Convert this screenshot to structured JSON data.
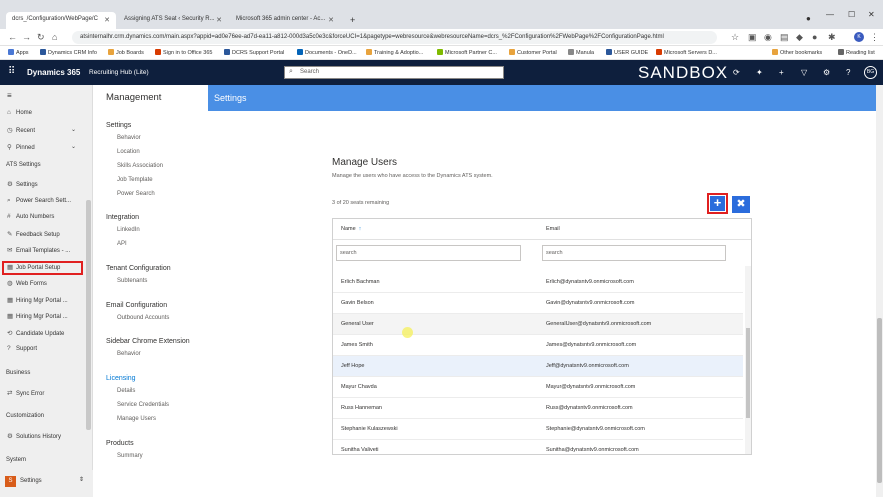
{
  "browser": {
    "tabs": [
      {
        "label": "dcrs_/Configuration/WebPage/C"
      },
      {
        "label": "Assigning ATS Seat ‹ Security R..."
      },
      {
        "label": "Microsoft 365 admin center - Ac..."
      }
    ],
    "new_tab": "+",
    "url": "atsinternalhr.crm.dynamics.com/main.aspx?appid=ad0e76ee-ad7d-ea11-a812-000d3a5c0e3c&forceUCI=1&pagetype=webresource&webresourceName=dcrs_%2FConfiguration%2FWebPage%2FConfigurationPage.html",
    "bookmarks": [
      "Apps",
      "Dynamics CRM Info",
      "Job Boards",
      "Sign in to Office 365",
      "DCRS Support Portal",
      "Documents - OneD...",
      "Training & Adoptio...",
      "Microsoft Partner C...",
      "Customer Portal",
      "Manula",
      "USER GUIDE",
      "Microsoft Servers D...",
      "Other bookmarks",
      "Reading list"
    ]
  },
  "appbar": {
    "app_name": "Dynamics 365",
    "app_title": "Recruiting Hub (Lite)",
    "search_placeholder": "Search",
    "environment": "SANDBOX",
    "avatar": "BG"
  },
  "leftnav": {
    "top": [
      {
        "label": "Home",
        "icon": "home-icon"
      },
      {
        "label": "Recent",
        "icon": "clock-icon"
      },
      {
        "label": "Pinned",
        "icon": "pin-icon"
      }
    ],
    "section_ats": "ATS Settings",
    "ats_items": [
      {
        "label": "Settings",
        "icon": "gear-icon"
      },
      {
        "label": "Power Search Sett...",
        "icon": "search-icon"
      },
      {
        "label": "Auto Numbers",
        "icon": "number-icon"
      },
      {
        "label": "Feedback Setup",
        "icon": "feedback-icon"
      },
      {
        "label": "Email Templates - ...",
        "icon": "email-icon"
      },
      {
        "label": "Job Portal Setup",
        "icon": "portal-icon"
      },
      {
        "label": "Web Forms",
        "icon": "globe-icon"
      },
      {
        "label": "Hiring Mgr Portal ...",
        "icon": "portal-icon"
      },
      {
        "label": "Hiring Mgr Portal ...",
        "icon": "portal-icon"
      },
      {
        "label": "Candidate Update",
        "icon": "update-icon"
      },
      {
        "label": "Support",
        "icon": "help-icon"
      }
    ],
    "section_business": "Business",
    "business_items": [
      {
        "label": "Sync Error",
        "icon": "sync-icon"
      }
    ],
    "section_customization": "Customization",
    "customization_items": [
      {
        "label": "Solutions History",
        "icon": "gear-icon"
      }
    ],
    "section_system": "System",
    "area_badge": "S",
    "area_label": "Settings"
  },
  "panel": {
    "title": "Management",
    "groups": [
      {
        "heading": "Settings",
        "items": [
          "Behavior",
          "Location",
          "Skills Association",
          "Job Template",
          "Power Search"
        ]
      },
      {
        "heading": "Integration",
        "items": [
          "LinkedIn",
          "API"
        ]
      },
      {
        "heading": "Tenant Configuration",
        "items": [
          "Subtenants"
        ]
      },
      {
        "heading": "Email Configuration",
        "items": [
          "Outbound Accounts"
        ]
      },
      {
        "heading": "Sidebar Chrome Extension",
        "items": [
          "Behavior"
        ]
      },
      {
        "heading": "Licensing",
        "items": [
          "Details",
          "Service Credentials",
          "Manage Users"
        ]
      },
      {
        "heading": "Products",
        "items": [
          "Summary"
        ]
      }
    ]
  },
  "main": {
    "header": "Settings",
    "title": "Manage Users",
    "description": "Manage the users who have access to the Dynamics ATS system.",
    "seats": "3 of 20 seats remaining",
    "add_label": "+",
    "remove_label": "✖",
    "columns": {
      "name": "Name",
      "email": "Email"
    },
    "sort_arrow": "↑",
    "name_filter_placeholder": "search",
    "email_filter_placeholder": "search",
    "rows": [
      {
        "name": "Erlich Bachman",
        "email": "Erlich@dynatsntv9.onmicrosoft.com"
      },
      {
        "name": "Gavin Belson",
        "email": "Gavin@dynatsntv9.onmicrosoft.com"
      },
      {
        "name": "General User",
        "email": "GeneralUser@dynatsntv9.onmicrosoft.com"
      },
      {
        "name": "James Smith",
        "email": "James@dynatsntv9.onmicrosoft.com"
      },
      {
        "name": "Jeff Hope",
        "email": "Jeff@dynatsntv9.onmicrosoft.com"
      },
      {
        "name": "Mayur Chavda",
        "email": "Mayur@dynatsntv9.onmicrosoft.com"
      },
      {
        "name": "Russ Hanneman",
        "email": "Russ@dynatsntv9.onmicrosoft.com"
      },
      {
        "name": "Stephanie Kulaszewski",
        "email": "Stephanie@dynatsntv9.onmicrosoft.com"
      },
      {
        "name": "Sunitha Valiveti",
        "email": "Sunitha@dynatsntv9.onmicrosoft.com"
      }
    ]
  }
}
